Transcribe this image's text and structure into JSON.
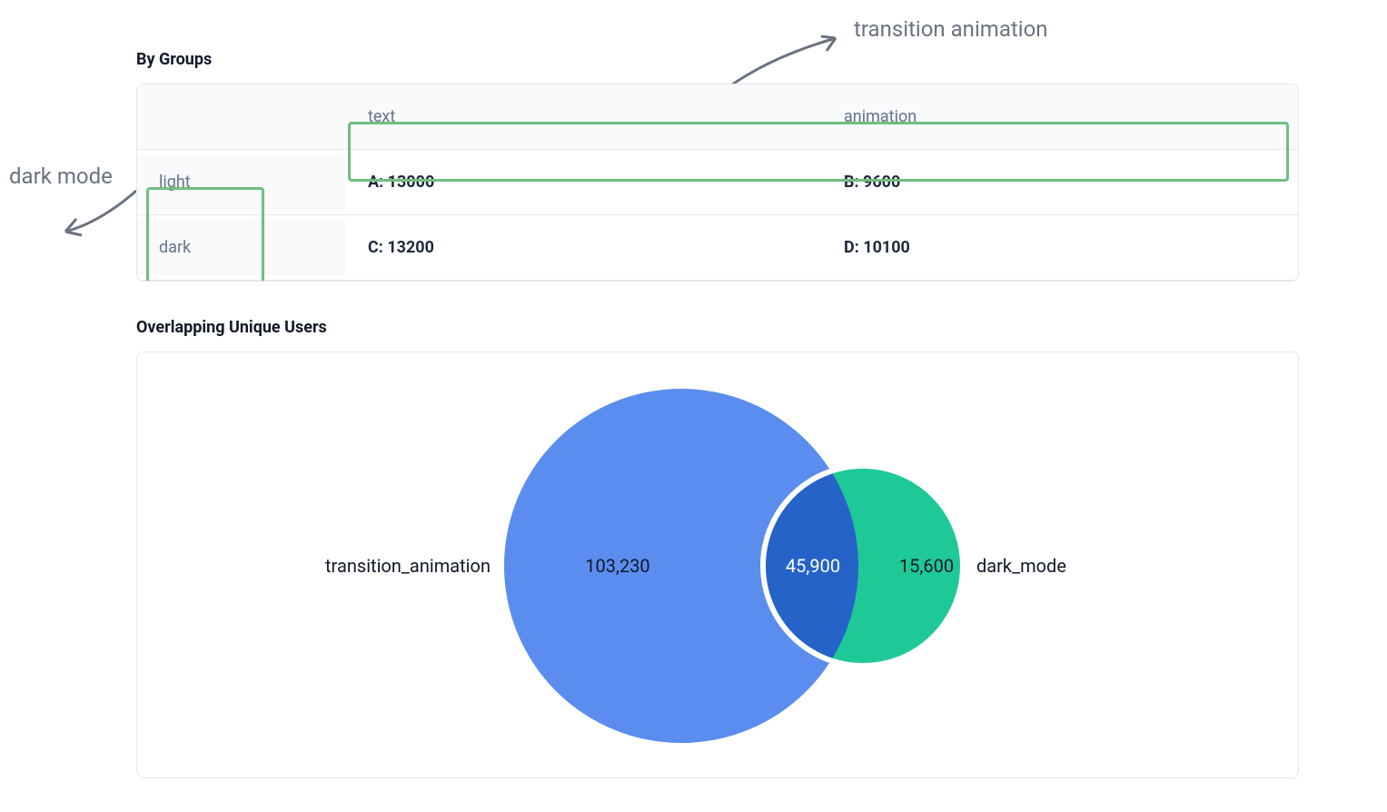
{
  "annotations": {
    "top_right": "transition animation",
    "left": "dark mode"
  },
  "groups": {
    "title": "By Groups",
    "columns": {
      "col1": "text",
      "col2": "animation"
    },
    "rows": [
      {
        "label": "light",
        "text_cell": "A: 13000",
        "animation_cell": "B: 9600"
      },
      {
        "label": "dark",
        "text_cell": "C: 13200",
        "animation_cell": "D: 10100"
      }
    ]
  },
  "venn": {
    "title": "Overlapping Unique Users",
    "left_label": "transition_animation",
    "right_label": "dark_mode",
    "left_value": "103,230",
    "intersection_value": "45,900",
    "right_value": "15,600"
  },
  "chart_data": [
    {
      "type": "table",
      "title": "By Groups",
      "columns": [
        "",
        "text",
        "animation"
      ],
      "rows": [
        [
          "light",
          13000,
          9600
        ],
        [
          "dark",
          13200,
          10100
        ]
      ],
      "column_group_label": "transition animation",
      "row_group_label": "dark mode"
    },
    {
      "type": "venn",
      "title": "Overlapping Unique Users",
      "sets": [
        {
          "name": "transition_animation",
          "exclusive": 103230
        },
        {
          "name": "dark_mode",
          "exclusive": 15600
        }
      ],
      "intersection": 45900
    }
  ]
}
